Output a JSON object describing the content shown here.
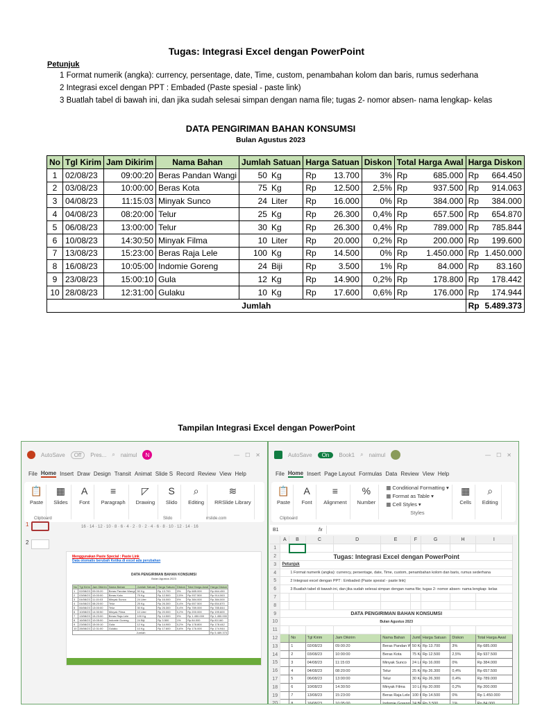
{
  "doc": {
    "title": "Tugas: Integrasi Excel dengan PowerPoint",
    "petunjuk": "Petunjuk",
    "steps": [
      "1 Format numerik  (angka):  currency, persentage, date, Time, custom, penambahan kolom dan baris, rumus sederhana",
      "2 Integrasi excel dengan PPT : Embaded (Paste spesial - paste link)",
      "3 Buatlah tabel di bawah ini, dan jika sudah selesai simpan dengan nama file; tugas 2- nomor absen- nama lengkap- kelas"
    ],
    "data_title": "DATA PENGIRIMAN BAHAN KONSUMSI",
    "data_subtitle": "Bulan Agustus 2023",
    "caption": "Tampilan Integrasi Excel dengan PowerPoint"
  },
  "table": {
    "headers": [
      "No",
      "Tgl Kirim",
      "Jam Dikirim",
      "Nama Bahan",
      "Jumlah Satuan",
      "Harga Satuan",
      "Diskon",
      "Total Harga Awal",
      "Harga Diskon"
    ],
    "rows": [
      [
        "1",
        "02/08/23",
        "09:00:20",
        "Beras Pandan Wangi",
        "50",
        "Kg",
        "Rp",
        "13.700",
        "3%",
        "Rp",
        "685.000",
        "Rp",
        "664.450"
      ],
      [
        "2",
        "03/08/23",
        "10:00:00",
        "Beras Kota",
        "75",
        "Kg",
        "Rp",
        "12.500",
        "2,5%",
        "Rp",
        "937.500",
        "Rp",
        "914.063"
      ],
      [
        "3",
        "04/08/23",
        "11:15:03",
        "Minyak Sunco",
        "24",
        "Liter",
        "Rp",
        "16.000",
        "0%",
        "Rp",
        "384.000",
        "Rp",
        "384.000"
      ],
      [
        "4",
        "04/08/23",
        "08:20:00",
        "Telur",
        "25",
        "Kg",
        "Rp",
        "26.300",
        "0,4%",
        "Rp",
        "657.500",
        "Rp",
        "654.870"
      ],
      [
        "5",
        "06/08/23",
        "13:00:00",
        "Telur",
        "30",
        "Kg",
        "Rp",
        "26.300",
        "0,4%",
        "Rp",
        "789.000",
        "Rp",
        "785.844"
      ],
      [
        "6",
        "10/08/23",
        "14:30:50",
        "Minyak Filma",
        "10",
        "Liter",
        "Rp",
        "20.000",
        "0,2%",
        "Rp",
        "200.000",
        "Rp",
        "199.600"
      ],
      [
        "7",
        "13/08/23",
        "15:23:00",
        "Beras Raja Lele",
        "100",
        "Kg",
        "Rp",
        "14.500",
        "0%",
        "Rp",
        "1.450.000",
        "Rp",
        "1.450.000"
      ],
      [
        "8",
        "16/08/23",
        "10:05:00",
        "Indomie Goreng",
        "24",
        "Biji",
        "Rp",
        "3.500",
        "1%",
        "Rp",
        "84.000",
        "Rp",
        "83.160"
      ],
      [
        "9",
        "23/08/23",
        "15:00:10",
        "Gula",
        "12",
        "Kg",
        "Rp",
        "14.900",
        "0,2%",
        "Rp",
        "178.800",
        "Rp",
        "178.442"
      ],
      [
        "10",
        "28/08/23",
        "12:31:00",
        "Gulaku",
        "10",
        "Kg",
        "Rp",
        "17.600",
        "0,6%",
        "Rp",
        "176.000",
        "Rp",
        "174.944"
      ]
    ],
    "total_label": "Jumlah",
    "total_currency": "Rp",
    "total_value": "5.489.373"
  },
  "ppt": {
    "autosave": "AutoSave",
    "toggle": "Off",
    "filename": "Pres...",
    "user": "naimul",
    "avatar": "N",
    "tabs": [
      "File",
      "Home",
      "Insert",
      "Draw",
      "Design",
      "Transit",
      "Animat",
      "Slide S",
      "Record",
      "Review",
      "View",
      "Help"
    ],
    "ribbon": [
      {
        "label": "Paste",
        "icon": "📋"
      },
      {
        "label": "Slides",
        "icon": "▦"
      },
      {
        "label": "Font",
        "icon": "A"
      },
      {
        "label": "Paragraph",
        "icon": "≡"
      },
      {
        "label": "Drawing",
        "icon": "◸"
      },
      {
        "label": "Slido",
        "icon": "S"
      },
      {
        "label": "Editing",
        "icon": "⌕"
      },
      {
        "label": "RRSlide Library",
        "icon": "≋"
      }
    ],
    "groups": [
      "Clipboard",
      "Slido",
      "rrslide.com"
    ],
    "ruler": "16 · 14 · 12 · 10 · 8 · 6 · 4 · 2 · 0 · 2 · 4 · 6 · 8 · 10 · 12 · 14 · 16",
    "slides": [
      "1",
      "2"
    ],
    "note_red": "Menggunakan Paste Special : Paste Link",
    "note_blue": "Data otomatis berubah Ketika di excel ada perubahan"
  },
  "excel": {
    "autosave": "AutoSave",
    "toggle": "On",
    "filename": "Book1",
    "user": "naimul",
    "tabs": [
      "File",
      "Home",
      "Insert",
      "Page Layout",
      "Formulas",
      "Data",
      "Review",
      "View",
      "Help"
    ],
    "ribbon": [
      {
        "label": "Paste",
        "icon": "📋"
      },
      {
        "label": "Font",
        "icon": "A"
      },
      {
        "label": "Alignment",
        "icon": "≡"
      },
      {
        "label": "Number",
        "icon": "%"
      }
    ],
    "styles": [
      "Conditional Formatting",
      "Format as Table",
      "Cell Styles"
    ],
    "styles_group": "Styles",
    "ribbon2": [
      {
        "label": "Cells",
        "icon": "▦"
      },
      {
        "label": "Editing",
        "icon": "⌕"
      }
    ],
    "clipboard": "Clipboard",
    "namebox": "B1",
    "fx": "fx",
    "columns": [
      "A",
      "B",
      "C",
      "D",
      "E",
      "F",
      "G",
      "H",
      "I"
    ]
  },
  "colors": {
    "header_fill": "#c6e0b4",
    "excel_green": "#107c41",
    "ppt_red": "#c43e1c"
  }
}
